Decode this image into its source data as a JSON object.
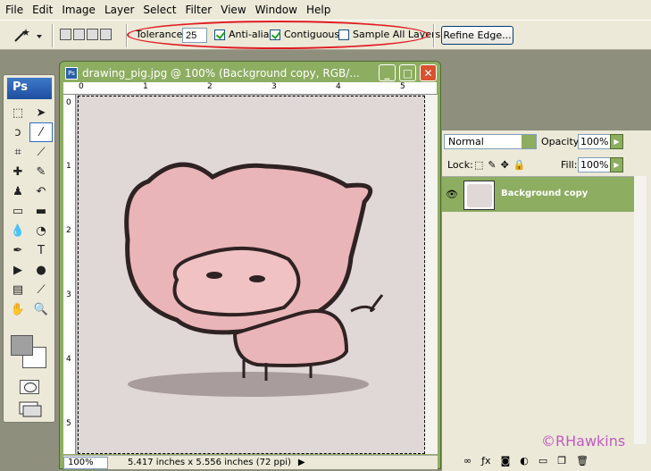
{
  "menu": [
    "File",
    "Edit",
    "Image",
    "Layer",
    "Select",
    "Filter",
    "View",
    "Window",
    "Help"
  ],
  "options": {
    "tolerance_label": "Tolerance:",
    "tolerance_value": "25",
    "antialias_label": "Anti-alias",
    "antialias_checked": true,
    "contiguous_label": "Contiguous",
    "contiguous_checked": true,
    "sample_all_label": "Sample All Layers",
    "sample_all_checked": false,
    "refine_edge_label": "Refine Edge..."
  },
  "toolbox": {
    "logo": "Ps",
    "selected_tool": "magic-wand"
  },
  "document": {
    "title": "drawing_pig.jpg @ 100% (Background copy, RGB/...",
    "ruler_h": [
      "0",
      "1",
      "2",
      "3",
      "4",
      "5"
    ],
    "ruler_v": [
      "0",
      "1",
      "2",
      "3",
      "4",
      "5"
    ],
    "zoom": "100%",
    "doc_info": "5.417 inches x 5.556 inches (72 ppi)"
  },
  "layers": {
    "blend_mode": "Normal",
    "opacity_label": "Opacity:",
    "opacity_value": "100%",
    "lock_label": "Lock:",
    "fill_label": "Fill:",
    "fill_value": "100%",
    "layer_name": "Background copy"
  },
  "watermark": "©RHawkins",
  "colors": {
    "accent_green": "#8dad61",
    "annotation_red": "#e21a22",
    "watermark": "#c15ac2"
  }
}
